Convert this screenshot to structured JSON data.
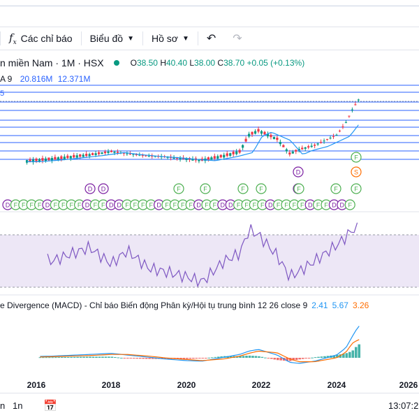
{
  "toolbar": {
    "indicators_label": "Các chỉ báo",
    "chart_label": "Biểu đồ",
    "profile_label": "Hồ sơ"
  },
  "legend": {
    "symbol": "n miền Nam · 1M · HSX",
    "o_key": "O",
    "o_val": "38.50",
    "h_key": "H",
    "h_val": "40.40",
    "l_key": "L",
    "l_val": "38.00",
    "c_key": "C",
    "c_val": "38.70",
    "change": "+0.05 (+0.13%)"
  },
  "volume": {
    "label": "A 9",
    "v1": "20.816M",
    "v2": "12.371M"
  },
  "edge_label": "5",
  "macd": {
    "title": "e Divergence (MACD) - Chỉ báo Biến động Phân kỳ/Hội tụ trung bình 12 26 close 9",
    "v1": "2.41",
    "v2": "5.67",
    "v3": "3.26"
  },
  "time_axis": [
    "2016",
    "2018",
    "2020",
    "2022",
    "2024",
    "2026"
  ],
  "bottom": {
    "left1": "n",
    "left2": "1n",
    "time": "13:07:2"
  },
  "colors": {
    "up": "#089981",
    "down": "#f23645",
    "blue": "#2962ff",
    "macd": "#2196f3",
    "signal": "#ff6d00",
    "rsi": "#7e57c2"
  },
  "events": {
    "row1": [
      "F"
    ],
    "row2": [
      "D",
      "S"
    ],
    "row3": [
      "D",
      "D",
      "F",
      "F",
      "F",
      "F",
      "D",
      "F",
      "F",
      "F",
      "D"
    ],
    "row4": [
      "D",
      "F",
      "F",
      "F",
      "F",
      "D",
      "F",
      "F",
      "F",
      "F",
      "D",
      "F",
      "F",
      "D"
    ]
  },
  "chart_data": {
    "type": "candlestick",
    "interval": "1M",
    "x": [
      "2015-10",
      "2016-06",
      "2017-06",
      "2018-01",
      "2018-06",
      "2019-01",
      "2019-06",
      "2020-01",
      "2020-06",
      "2021-01",
      "2021-06",
      "2021-09",
      "2021-12",
      "2022-06",
      "2022-10",
      "2023-01",
      "2023-06",
      "2024-01",
      "2024-04",
      "2024-06",
      "2024-08"
    ],
    "price": [
      9.5,
      10.5,
      12.5,
      14,
      13,
      12,
      11.5,
      10.5,
      10,
      12,
      14,
      22,
      24,
      20,
      13,
      15,
      17,
      22,
      28,
      34,
      38.7
    ],
    "rsi": [
      60,
      55,
      68,
      52,
      65,
      48,
      45,
      40,
      35,
      55,
      62,
      85,
      80,
      60,
      40,
      45,
      55,
      70,
      78,
      85,
      86
    ],
    "macd": [
      0.2,
      0.3,
      0.6,
      0.8,
      0.5,
      0.1,
      -0.2,
      -0.5,
      -0.6,
      0.1,
      0.6,
      1.2,
      1.5,
      0.5,
      -0.8,
      -1.0,
      -0.6,
      0.5,
      1.8,
      3.8,
      5.67
    ],
    "signal": [
      0.1,
      0.2,
      0.4,
      0.6,
      0.6,
      0.3,
      0.0,
      -0.3,
      -0.5,
      -0.2,
      0.3,
      0.8,
      1.2,
      0.9,
      -0.2,
      -0.7,
      -0.7,
      0.0,
      1.0,
      2.6,
      3.26
    ]
  }
}
